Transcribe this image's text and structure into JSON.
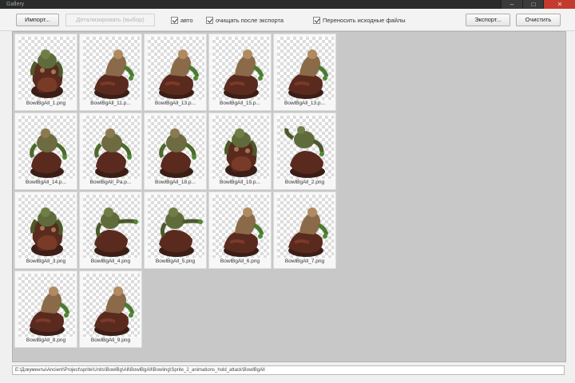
{
  "window": {
    "title": "Gallery"
  },
  "toolbar": {
    "import_label": "Импорт...",
    "disabled_label": "Детализировать (выбор)",
    "checks": [
      {
        "label": "авто",
        "checked": true
      },
      {
        "label": "очищать после экспорта",
        "checked": true
      },
      {
        "label": "Переносить исходные файлы",
        "checked": true
      }
    ],
    "export_label": "Экспорт...",
    "clear_label": "Очистить"
  },
  "tiles": [
    {
      "caption": "BowlBgAll_1.png",
      "sprite": "a"
    },
    {
      "caption": "BowlBgAll_11.p...",
      "sprite": "b"
    },
    {
      "caption": "BowlBgAll_13.p...",
      "sprite": "b"
    },
    {
      "caption": "BowlBgAll_15.p...",
      "sprite": "b"
    },
    {
      "caption": "BowlBgAll_13.p...",
      "sprite": "b"
    },
    {
      "caption": "BowlBgAll_14.p...",
      "sprite": "c"
    },
    {
      "caption": "BowlBgAll_Pa.p...",
      "sprite": "c"
    },
    {
      "caption": "BowlBgAll_18.p...",
      "sprite": "c"
    },
    {
      "caption": "BowlBgAll_19.p...",
      "sprite": "a"
    },
    {
      "caption": "BowlBgAll_2.png",
      "sprite": "d"
    },
    {
      "caption": "BowlBgAll_3.png",
      "sprite": "a"
    },
    {
      "caption": "BowlBgAll_4.png",
      "sprite": "e"
    },
    {
      "caption": "BowlBgAll_5.png",
      "sprite": "e"
    },
    {
      "caption": "BowlBgAll_6.png",
      "sprite": "b"
    },
    {
      "caption": "BowlBgAll_7.png",
      "sprite": "b"
    },
    {
      "caption": "BowlBgAll_8.png",
      "sprite": "b"
    },
    {
      "caption": "BowlBgAll_9.png",
      "sprite": "b"
    }
  ],
  "statusbar": {
    "path": "E:\\Документы\\Ancient\\Project\\sprite\\Units\\BowlBg\\All\\BowlBgAll\\Bowling\\Sprite_2_animations_hold_attack\\BowlBgAll"
  },
  "colors": {
    "window_bg": "#f0f0f0",
    "gallery_bg": "#c8c8c8",
    "titlebar": "#2b2b2b",
    "close": "#c43a2e"
  }
}
